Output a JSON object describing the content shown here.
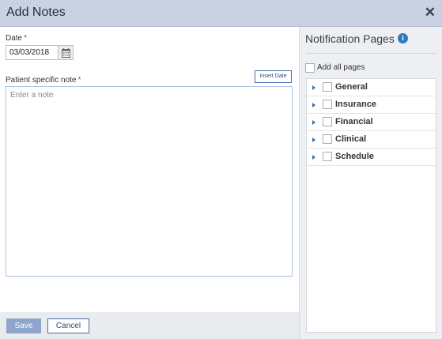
{
  "dialog": {
    "title": "Add Notes",
    "close_icon": "close-icon"
  },
  "form": {
    "date_label": "Date",
    "required_mark": "*",
    "date_value": "03/03/2018",
    "calendar_icon": "calendar-icon",
    "note_label": "Patient specific note",
    "insert_date_label": "Insert Date",
    "note_placeholder": "Enter a note",
    "note_value": ""
  },
  "footer": {
    "save_label": "Save",
    "cancel_label": "Cancel"
  },
  "notification_pages": {
    "title": "Notification Pages",
    "info_icon": "info-icon",
    "info_glyph": "i",
    "add_all_label": "Add all pages",
    "pages": [
      {
        "label": "General",
        "checked": false
      },
      {
        "label": "Insurance",
        "checked": false
      },
      {
        "label": "Financial",
        "checked": false
      },
      {
        "label": "Clinical",
        "checked": false
      },
      {
        "label": "Schedule",
        "checked": false
      }
    ]
  },
  "colors": {
    "titlebar": "#c9d2e3",
    "accent": "#2e7bc4",
    "save_button": "#8fa5cb"
  }
}
